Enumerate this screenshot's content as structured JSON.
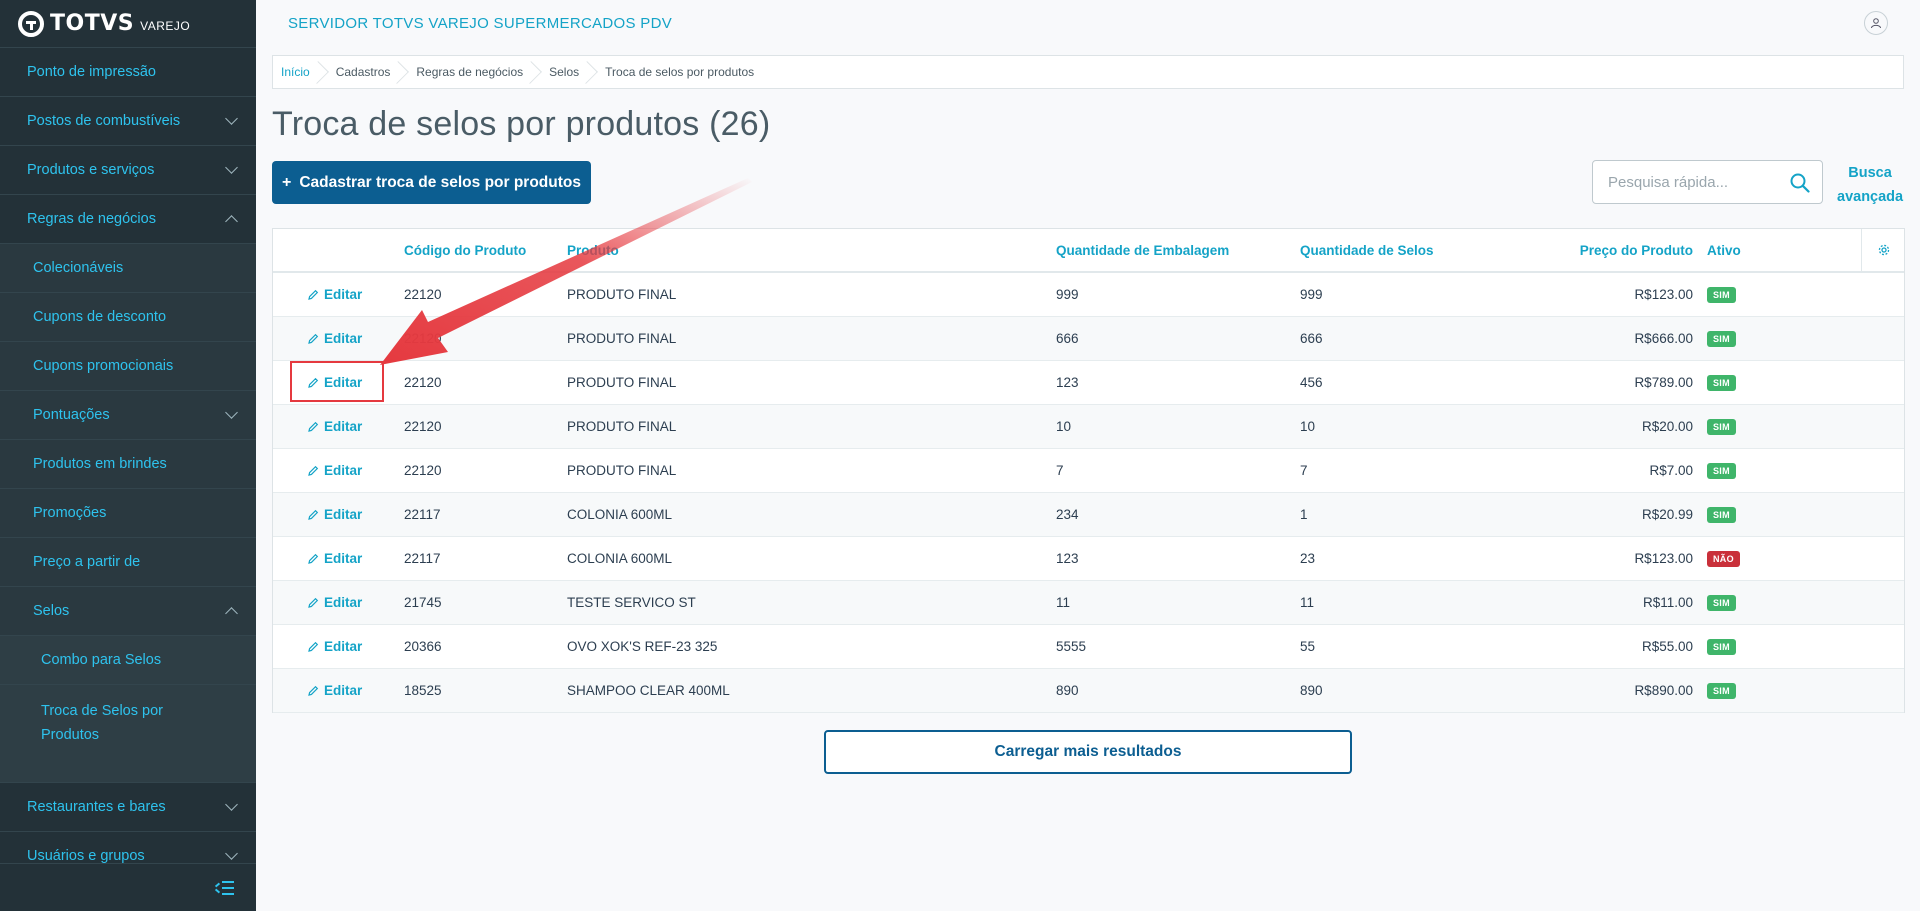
{
  "app": {
    "logo_text": "TOTVS",
    "logo_sub": "VAREJO",
    "server_title": "SERVIDOR TOTVS VAREJO SUPERMERCADOS PDV"
  },
  "sidebar": {
    "items": [
      {
        "label": "Ponto de impressão",
        "level": 1,
        "chevron": "none"
      },
      {
        "label": "Postos de combustíveis",
        "level": 1,
        "chevron": "down"
      },
      {
        "label": "Produtos e serviços",
        "level": 1,
        "chevron": "down"
      },
      {
        "label": "Regras de negócios",
        "level": 1,
        "chevron": "up"
      },
      {
        "label": "Colecionáveis",
        "level": 2,
        "chevron": "none"
      },
      {
        "label": "Cupons de desconto",
        "level": 2,
        "chevron": "none"
      },
      {
        "label": "Cupons promocionais",
        "level": 2,
        "chevron": "none"
      },
      {
        "label": "Pontuações",
        "level": 2,
        "chevron": "down"
      },
      {
        "label": "Produtos em brindes",
        "level": 2,
        "chevron": "none"
      },
      {
        "label": "Promoções",
        "level": 2,
        "chevron": "none"
      },
      {
        "label": "Preço a partir de",
        "level": 2,
        "chevron": "none"
      },
      {
        "label": "Selos",
        "level": 2,
        "chevron": "up"
      },
      {
        "label": "Combo para Selos",
        "level": 3,
        "chevron": "none"
      },
      {
        "label": "Troca de Selos por Produtos",
        "level": 3,
        "chevron": "none"
      },
      {
        "label": "Restaurantes e bares",
        "level": 1,
        "chevron": "down"
      },
      {
        "label": "Usuários e grupos",
        "level": 1,
        "chevron": "down"
      }
    ]
  },
  "breadcrumb": [
    "Início",
    "Cadastros",
    "Regras de negócios",
    "Selos",
    "Troca de selos por produtos"
  ],
  "page": {
    "title": "Troca de selos por produtos (26)",
    "add_button": "Cadastrar troca de selos por produtos",
    "add_button_icon": "+",
    "search_placeholder": "Pesquisa rápida...",
    "advanced_search_line1": "Busca",
    "advanced_search_line2": "avançada",
    "load_more": "Carregar mais resultados"
  },
  "table": {
    "headers": {
      "codigo": "Código do Produto",
      "produto": "Produto",
      "qtd_embalagem": "Quantidade de Embalagem",
      "qtd_selos": "Quantidade de Selos",
      "preco": "Preço do Produto",
      "ativo": "Ativo"
    },
    "edit_label": "Editar",
    "rows": [
      {
        "codigo": "22120",
        "produto": "PRODUTO FINAL",
        "qtd_embalagem": "999",
        "qtd_selos": "999",
        "preco": "R$123.00",
        "ativo": "SIM"
      },
      {
        "codigo": "22120",
        "produto": "PRODUTO FINAL",
        "qtd_embalagem": "666",
        "qtd_selos": "666",
        "preco": "R$666.00",
        "ativo": "SIM"
      },
      {
        "codigo": "22120",
        "produto": "PRODUTO FINAL",
        "qtd_embalagem": "123",
        "qtd_selos": "456",
        "preco": "R$789.00",
        "ativo": "SIM"
      },
      {
        "codigo": "22120",
        "produto": "PRODUTO FINAL",
        "qtd_embalagem": "10",
        "qtd_selos": "10",
        "preco": "R$20.00",
        "ativo": "SIM"
      },
      {
        "codigo": "22120",
        "produto": "PRODUTO FINAL",
        "qtd_embalagem": "7",
        "qtd_selos": "7",
        "preco": "R$7.00",
        "ativo": "SIM"
      },
      {
        "codigo": "22117",
        "produto": "COLONIA 600ML",
        "qtd_embalagem": "234",
        "qtd_selos": "1",
        "preco": "R$20.99",
        "ativo": "SIM"
      },
      {
        "codigo": "22117",
        "produto": "COLONIA 600ML",
        "qtd_embalagem": "123",
        "qtd_selos": "23",
        "preco": "R$123.00",
        "ativo": "NÃO"
      },
      {
        "codigo": "21745",
        "produto": "TESTE SERVICO ST",
        "qtd_embalagem": "11",
        "qtd_selos": "11",
        "preco": "R$11.00",
        "ativo": "SIM"
      },
      {
        "codigo": "20366",
        "produto": "OVO XOK'S REF-23 325",
        "qtd_embalagem": "5555",
        "qtd_selos": "55",
        "preco": "R$55.00",
        "ativo": "SIM"
      },
      {
        "codigo": "18525",
        "produto": "SHAMPOO CLEAR 400ML",
        "qtd_embalagem": "890",
        "qtd_selos": "890",
        "preco": "R$890.00",
        "ativo": "SIM"
      }
    ]
  },
  "colors": {
    "sidebar_bg": "#233138",
    "accent": "#14a3c7",
    "primary_button": "#0c5e91",
    "badge_yes": "#3fb56a",
    "badge_no": "#c9303a",
    "annotation_red": "#e5393f"
  }
}
